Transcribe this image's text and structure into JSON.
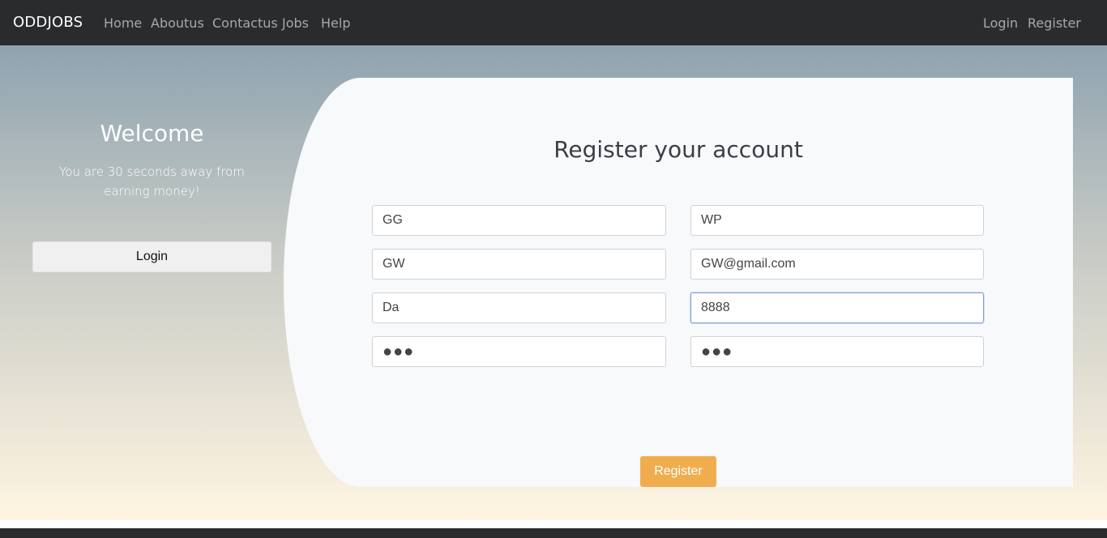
{
  "navbar": {
    "brand": "ODDJOBS",
    "links": [
      "Home",
      "Aboutus",
      "Contactus",
      "Jobs",
      "Help"
    ],
    "right_links": [
      "Login",
      "Register"
    ]
  },
  "sidebar": {
    "title": "Welcome",
    "subtitle": "You are 30 seconds away from earning money!",
    "login_label": "Login"
  },
  "form": {
    "title": "Register your account",
    "fields": [
      {
        "value": "GG"
      },
      {
        "value": "WP"
      },
      {
        "value": "GW"
      },
      {
        "value": "GW@gmail.com"
      },
      {
        "value": "Da"
      },
      {
        "value": "8888"
      },
      {
        "value": "●●●"
      },
      {
        "value": "●●●"
      }
    ],
    "register_label": "Register"
  },
  "colors": {
    "navbar": "#292b2c",
    "register_button": "#f0ad4e",
    "panel": "#f7f9fb"
  }
}
